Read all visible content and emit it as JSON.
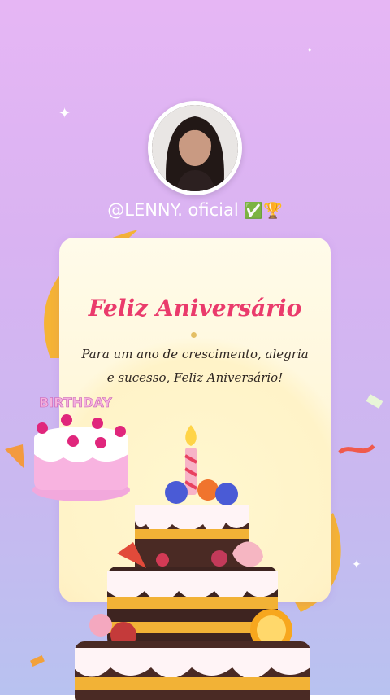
{
  "profile": {
    "handle": "@LENNY. oficial",
    "badges": "✅🏆"
  },
  "card": {
    "title": "Feliz Aniversário",
    "message": "Para um ano de crescimento, alegria e sucesso, Feliz Aniversário!"
  },
  "sticker": {
    "text": "BIRTHDAY"
  },
  "colors": {
    "background_top": "#e6b6f4",
    "background_bottom": "#b8c2f0",
    "title": "#ea3b6c",
    "ribbon": "#f7b93c"
  }
}
